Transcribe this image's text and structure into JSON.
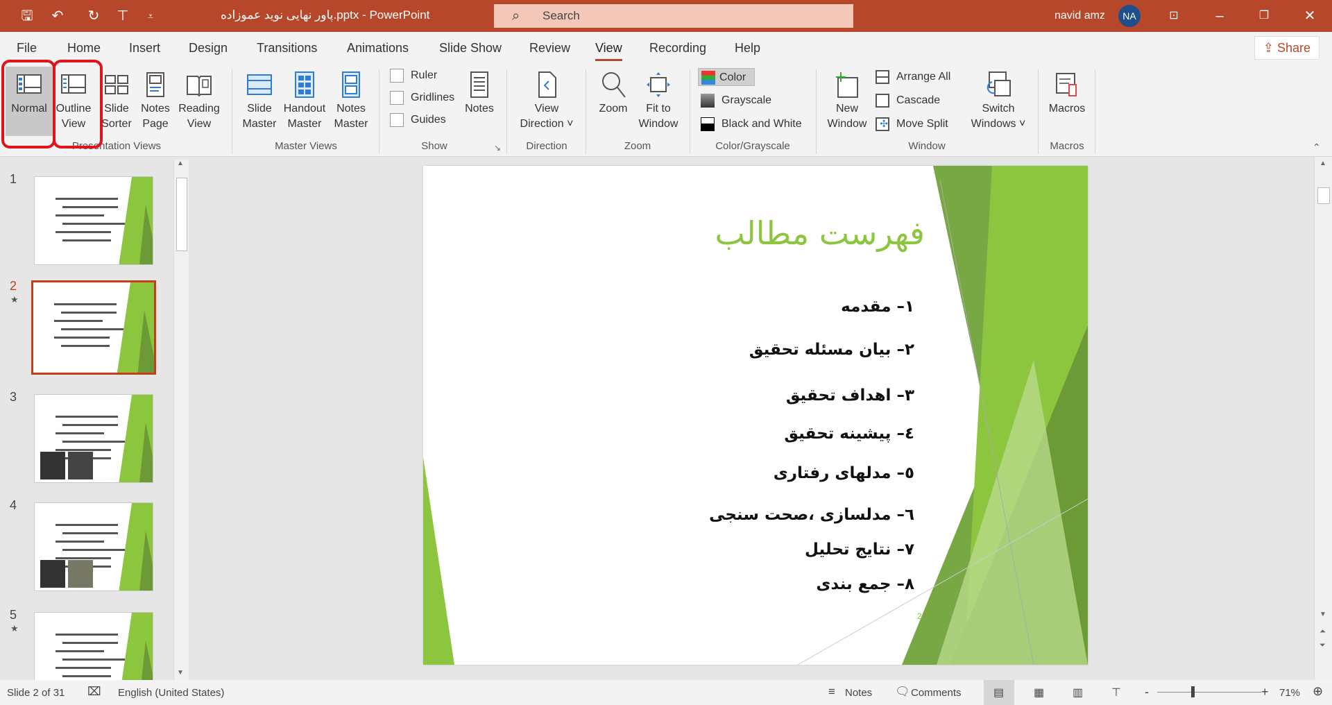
{
  "titlebar": {
    "doc_title": "پاور نهایی نوید عموزاده.pptx  -  PowerPoint",
    "search_placeholder": "Search",
    "user_name": "navid amz",
    "avatar_initials": "NA",
    "accent": "#b7472a"
  },
  "tabs": [
    "File",
    "Home",
    "Insert",
    "Design",
    "Transitions",
    "Animations",
    "Slide Show",
    "Review",
    "View",
    "Recording",
    "Help"
  ],
  "active_tab": "View",
  "share_label": "Share",
  "ribbon": {
    "presentation_views": {
      "label": "Presentation Views",
      "buttons": [
        [
          "Normal",
          ""
        ],
        [
          "Outline",
          "View"
        ],
        [
          "Slide",
          "Sorter"
        ],
        [
          "Notes",
          "Page"
        ],
        [
          "Reading",
          "View"
        ]
      ]
    },
    "master_views": {
      "label": "Master Views",
      "buttons": [
        [
          "Slide",
          "Master"
        ],
        [
          "Handout",
          "Master"
        ],
        [
          "Notes",
          "Master"
        ]
      ]
    },
    "show": {
      "label": "Show",
      "checkboxes": [
        "Ruler",
        "Gridlines",
        "Guides"
      ],
      "notes": "Notes"
    },
    "direction": {
      "label": "Direction",
      "button": [
        "View",
        "Direction ˅"
      ]
    },
    "zoom": {
      "label": "Zoom",
      "zoom": "Zoom",
      "fit": [
        "Fit to",
        "Window"
      ]
    },
    "color": {
      "label": "Color/Grayscale",
      "items": [
        "Color",
        "Grayscale",
        "Black and White"
      ]
    },
    "window": {
      "label": "Window",
      "new": [
        "New",
        "Window"
      ],
      "items": [
        "Arrange All",
        "Cascade",
        "Move Split"
      ],
      "switch": [
        "Switch",
        "Windows ˅"
      ]
    },
    "macros": {
      "label": "Macros",
      "button": "Macros"
    }
  },
  "thumbnails": [
    "1",
    "2",
    "3",
    "4",
    "5"
  ],
  "selected_slide": 2,
  "slide": {
    "title": "فهرست مطالب",
    "items": [
      "۱– مقدمه",
      "۲– بیان مسئله تحقیق",
      "۳– اهداف تحقیق",
      "٤– پیشینه تحقیق",
      "٥– مدلهای رفتاری",
      "٦– مدلسازی ،صحت سنجی",
      "۷– نتایج تحلیل",
      "۸– جمع بندی"
    ],
    "page_number": "2",
    "title_color": "#8cc63f"
  },
  "status": {
    "slide_info": "Slide 2 of 31",
    "language": "English (United States)",
    "notes": "Notes",
    "comments": "Comments",
    "zoom": "71%",
    "zoom_level": 71,
    "minus": "-",
    "plus": "+"
  }
}
